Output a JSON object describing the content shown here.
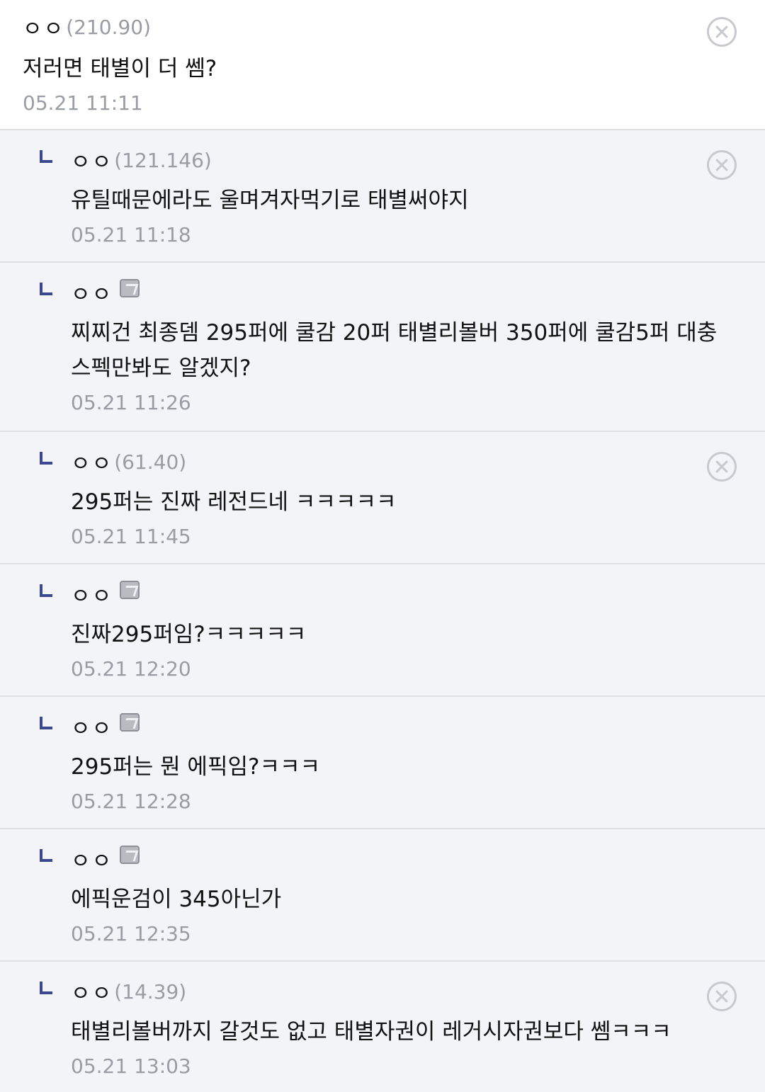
{
  "comments": [
    {
      "nick": "ㅇㅇ",
      "ip": "(210.90)",
      "text": "저러면 태별이 더 쎔?",
      "date": "05.21 11:11"
    },
    {
      "nick": "ㅇㅇ",
      "ip": "(121.146)",
      "text": "유틸때문에라도 울며겨자먹기로 태별써야지",
      "date": "05.21 11:18"
    },
    {
      "nick": "ㅇㅇ",
      "ip": "",
      "text": "찌찌건 최종뎀 295퍼에 쿨감 20퍼 태별리볼버 350퍼에 쿨감5퍼 대충 스펙만봐도 알겠지?",
      "date": "05.21 11:26"
    },
    {
      "nick": "ㅇㅇ",
      "ip": "(61.40)",
      "text": "295퍼는 진짜 레전드네 ㅋㅋㅋㅋㅋ",
      "date": "05.21 11:45"
    },
    {
      "nick": "ㅇㅇ",
      "ip": "",
      "text": "진짜295퍼임?ㅋㅋㅋㅋㅋ",
      "date": "05.21 12:20"
    },
    {
      "nick": "ㅇㅇ",
      "ip": "",
      "text": "295퍼는 뭔 에픽임?ㅋㅋㅋ",
      "date": "05.21 12:28"
    },
    {
      "nick": "ㅇㅇ",
      "ip": "",
      "text": "에픽운검이 345아닌가",
      "date": "05.21 12:35"
    },
    {
      "nick": "ㅇㅇ",
      "ip": "(14.39)",
      "text": "태별리볼버까지 갈것도 없고 태별자권이 레거시자권보다 쎔ㅋㅋㅋ",
      "date": "05.21 13:03"
    }
  ],
  "icons": {
    "delete": "delete-circle-x-icon",
    "reply": "reply-arrow-icon",
    "member": "fixed-nick-member-icon"
  },
  "colors": {
    "reply_background": "#f3f4f7",
    "reply_mark": "#3b4890",
    "meta_gray": "#9a9ca3"
  }
}
